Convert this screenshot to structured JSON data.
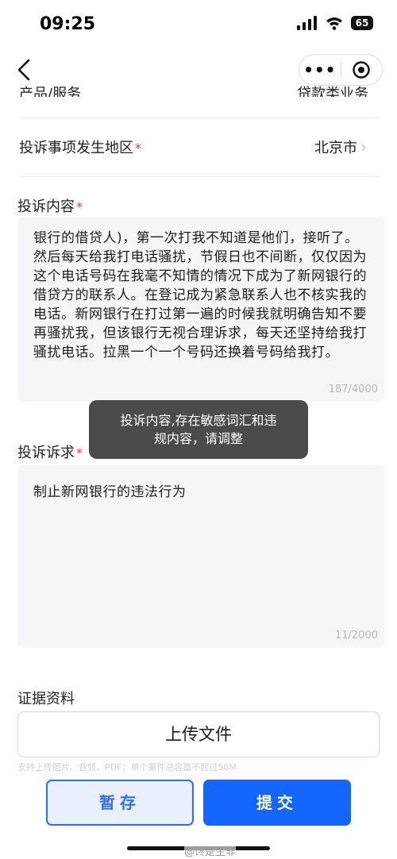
{
  "status_bar": {
    "time": "09:25",
    "battery": "65"
  },
  "rows": {
    "prev_label": "产品/服务",
    "prev_value": "贷款类业务",
    "region_label": "投诉事项发生地区",
    "region_value": "北京市",
    "required_mark": "*"
  },
  "content": {
    "label": "投诉内容",
    "text": "银行的借贷人)，第一次打我不知道是他们，接听了。然后每天给我打电话骚扰，节假日也不间断，仅仅因为这个电话号码在我毫不知情的情况下成为了新网银行的借贷方的联系人。在登记成为紧急联系人也不核实我的电话。新网银行在打过第一遍的时候我就明确告知不要再骚扰我，但该银行无视合理诉求，每天还坚持给我打骚扰电话。拉黑一个一个号码还换着号码给我打。",
    "counter": "187/4000"
  },
  "toast": {
    "line1": "投诉内容,存在敏感词汇和违",
    "line2": "规内容，请调整"
  },
  "demand": {
    "label": "投诉诉求",
    "text": "制止新网银行的违法行为",
    "counter": "11/2000"
  },
  "evidence": {
    "label": "证据资料",
    "upload_label": "上传文件",
    "hint": "支持上传图片、音频、PDF；单个案件总容量不超过50M"
  },
  "actions": {
    "save_label": "暂存",
    "submit_label": "提交"
  },
  "watermark": "@馋是生非",
  "colors": {
    "primary": "#1565ff",
    "required": "#e53935"
  }
}
